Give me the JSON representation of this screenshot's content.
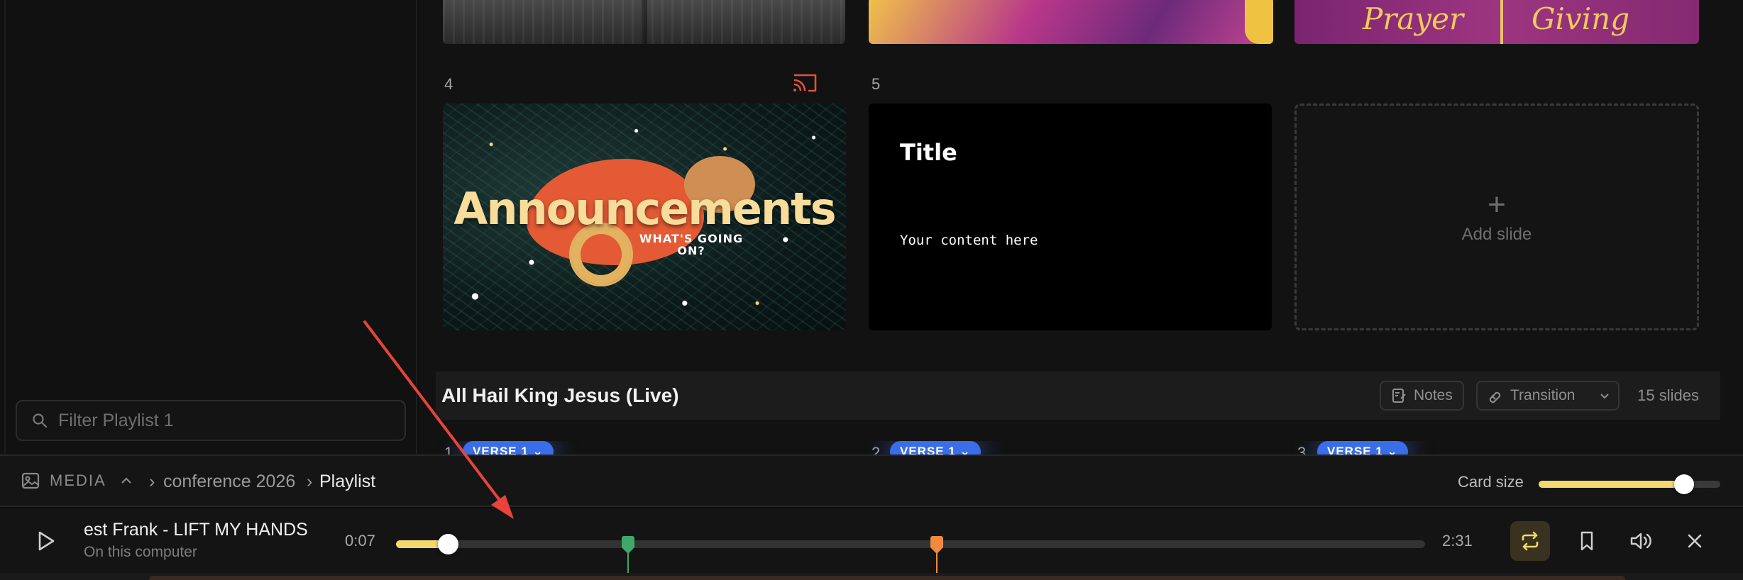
{
  "sidebar": {
    "filter_placeholder": "Filter Playlist 1"
  },
  "slides_top": {
    "prayer_text": "Prayer",
    "giving_text": "Giving"
  },
  "slides": [
    {
      "number": "4",
      "title": "Announcements",
      "subtitle_line1": "WHAT'S GOING",
      "subtitle_line2": "ON?"
    },
    {
      "number": "5",
      "title": "Title",
      "content": "Your content here"
    }
  ],
  "add_slide": {
    "plus": "+",
    "label": "Add slide"
  },
  "song": {
    "title": "All Hail King Jesus (Live)",
    "notes_label": "Notes",
    "transition_label": "Transition",
    "slides_count": "15 slides",
    "verses": [
      {
        "number": "1",
        "label": "VERSE 1"
      },
      {
        "number": "2",
        "label": "VERSE 1"
      },
      {
        "number": "3",
        "label": "VERSE 1"
      }
    ]
  },
  "media_bar": {
    "label": "MEDIA",
    "breadcrumb": [
      "conference 2026",
      "Playlist"
    ],
    "card_size_label": "Card size",
    "card_size_level": 0.8
  },
  "player": {
    "track_title": "est Frank - LIFT MY HANDS",
    "source": "On this computer",
    "current_time": "0:07",
    "total_time": "2:31",
    "progress": 0.05,
    "markers": [
      {
        "position": 0.225,
        "color": "#3fa96a"
      },
      {
        "position": 0.525,
        "color": "#f08a3e"
      }
    ]
  },
  "colors": {
    "accent_yellow": "#f3d96b",
    "verse_blue": "#3a6ee8",
    "cast_red": "#e0513f",
    "annotation_red": "#e8443a"
  },
  "icons": {
    "search": "search-icon",
    "cast": "cast-icon",
    "notes": "notes-icon",
    "transition": "transition-icon",
    "media": "image-icon",
    "play": "play-icon",
    "repeat": "repeat-icon",
    "bookmark": "bookmark-icon",
    "volume": "volume-icon",
    "close": "close-icon"
  }
}
